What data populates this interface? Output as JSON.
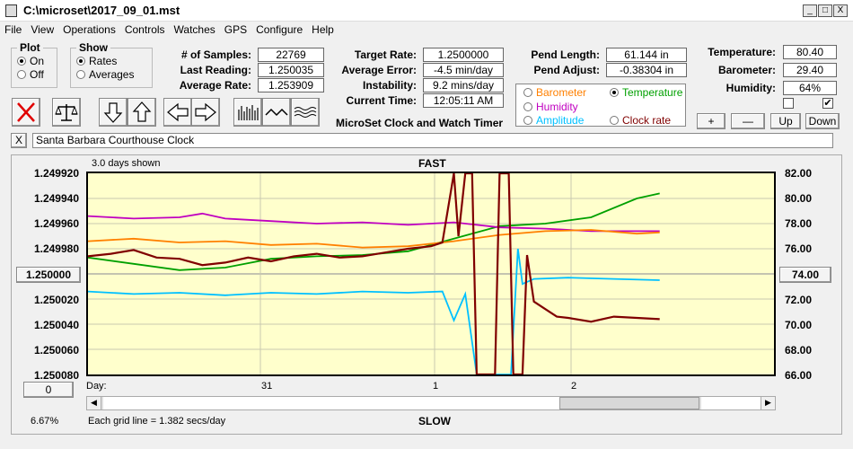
{
  "window": {
    "title": "C:\\microset\\2017_09_01.mst",
    "min": "_",
    "max": "□",
    "close": "X"
  },
  "menu": [
    "File",
    "View",
    "Operations",
    "Controls",
    "Watches",
    "GPS",
    "Configure",
    "Help"
  ],
  "plot_group": {
    "title": "Plot",
    "options": [
      "On",
      "Off"
    ],
    "selected": "On"
  },
  "show_group": {
    "title": "Show",
    "options": [
      "Rates",
      "Averages"
    ],
    "selected": "Rates"
  },
  "stats": {
    "samples_label": "# of Samples:",
    "samples": "22769",
    "last_label": "Last Reading:",
    "last": "1.250035",
    "avg_label": "Average Rate:",
    "avg": "1.253909",
    "target_label": "Target Rate:",
    "target": "1.2500000",
    "avgerr_label": "Average Error:",
    "avgerr": "-4.5 min/day",
    "instab_label": "Instability:",
    "instab": "9.2 mins/day",
    "time_label": "Current Time:",
    "time": "12:05:11 AM",
    "pendlen_label": "Pend Length:",
    "pendlen": "61.144 in",
    "pendadj_label": "Pend Adjust:",
    "pendadj": "-0.38304 in",
    "temp_label": "Temperature:",
    "temp": "80.40",
    "baro_label": "Barometer:",
    "baro": "29.40",
    "hum_label": "Humidity:",
    "hum": "64%"
  },
  "app_name": "MicroSet Clock and Watch Timer",
  "sensor_options": [
    {
      "label": "Barometer",
      "color": "#ff8000",
      "selected": false
    },
    {
      "label": "Temperature",
      "color": "#00a000",
      "selected": true
    },
    {
      "label": "Humidity",
      "color": "#c000c0",
      "selected": false
    },
    {
      "label": "Amplitude",
      "color": "#00c0ff",
      "selected": false
    },
    {
      "label": "Clock rate",
      "color": "#800000",
      "selected": false
    }
  ],
  "axis_buttons": {
    "plus": "+",
    "minus": "—",
    "up": "Up",
    "down": "Down"
  },
  "checkboxes": {
    "left": "",
    "right": "✔"
  },
  "clock_name": "Santa Barbara Courthouse Clock",
  "clear_btn": "X",
  "chart_header": {
    "days_shown": "3.0 days shown",
    "fast": "FAST",
    "slow": "SLOW"
  },
  "left_center_btn": "1.250000",
  "right_center_btn": "74.00",
  "zero_btn": "0",
  "day_label": "Day:",
  "footer_pct": "6.67%",
  "grid_note": "Each grid line = 1.382 secs/day",
  "chart_data": {
    "type": "line",
    "y_left_ticks": [
      "1.249920",
      "1.249940",
      "1.249960",
      "1.249980",
      "1.250000",
      "1.250020",
      "1.250040",
      "1.250060",
      "1.250080"
    ],
    "y_right_ticks": [
      "82.00",
      "80.00",
      "78.00",
      "76.00",
      "74.00",
      "72.00",
      "70.00",
      "68.00",
      "66.00"
    ],
    "x_ticks": [
      "31",
      "1",
      "2"
    ],
    "x_range_days": [
      0,
      3
    ],
    "ylim_left": [
      1.24992,
      1.25008
    ],
    "ylim_right": [
      66,
      82
    ],
    "series": [
      {
        "name": "Clock rate",
        "color": "#800000",
        "points": [
          [
            0,
            75.4
          ],
          [
            0.1,
            75.6
          ],
          [
            0.2,
            75.9
          ],
          [
            0.3,
            75.3
          ],
          [
            0.4,
            75.2
          ],
          [
            0.5,
            74.7
          ],
          [
            0.6,
            74.9
          ],
          [
            0.7,
            75.3
          ],
          [
            0.8,
            75.0
          ],
          [
            0.9,
            75.4
          ],
          [
            1.0,
            75.6
          ],
          [
            1.1,
            75.3
          ],
          [
            1.2,
            75.4
          ],
          [
            1.3,
            75.7
          ],
          [
            1.4,
            76.0
          ],
          [
            1.5,
            76.2
          ],
          [
            1.55,
            76.5
          ],
          [
            1.6,
            82
          ],
          [
            1.62,
            77
          ],
          [
            1.65,
            82
          ],
          [
            1.68,
            82
          ],
          [
            1.7,
            66
          ],
          [
            1.72,
            66
          ],
          [
            1.75,
            66
          ],
          [
            1.78,
            66
          ],
          [
            1.8,
            82
          ],
          [
            1.84,
            82
          ],
          [
            1.86,
            66
          ],
          [
            1.9,
            66
          ],
          [
            1.92,
            75.5
          ],
          [
            1.95,
            71.8
          ],
          [
            2.0,
            71.2
          ],
          [
            2.05,
            70.6
          ],
          [
            2.1,
            70.5
          ],
          [
            2.2,
            70.2
          ],
          [
            2.3,
            70.6
          ],
          [
            2.4,
            70.5
          ],
          [
            2.5,
            70.4
          ]
        ]
      },
      {
        "name": "Temperature",
        "color": "#00a000",
        "points": [
          [
            0,
            75.3
          ],
          [
            0.2,
            74.8
          ],
          [
            0.4,
            74.3
          ],
          [
            0.6,
            74.5
          ],
          [
            0.8,
            75.2
          ],
          [
            1.0,
            75.4
          ],
          [
            1.2,
            75.5
          ],
          [
            1.4,
            75.8
          ],
          [
            1.6,
            76.8
          ],
          [
            1.8,
            77.8
          ],
          [
            2.0,
            78.0
          ],
          [
            2.2,
            78.5
          ],
          [
            2.4,
            80.0
          ],
          [
            2.5,
            80.4
          ]
        ]
      },
      {
        "name": "Humidity",
        "color": "#c000c0",
        "points": [
          [
            0,
            78.6
          ],
          [
            0.2,
            78.4
          ],
          [
            0.4,
            78.5
          ],
          [
            0.5,
            78.8
          ],
          [
            0.6,
            78.4
          ],
          [
            0.8,
            78.2
          ],
          [
            1.0,
            78.0
          ],
          [
            1.2,
            78.1
          ],
          [
            1.4,
            77.9
          ],
          [
            1.6,
            78.1
          ],
          [
            1.8,
            77.7
          ],
          [
            2.0,
            77.6
          ],
          [
            2.2,
            77.4
          ],
          [
            2.4,
            77.4
          ],
          [
            2.5,
            77.4
          ]
        ]
      },
      {
        "name": "Barometer",
        "color": "#ff8000",
        "points": [
          [
            0,
            76.6
          ],
          [
            0.2,
            76.8
          ],
          [
            0.4,
            76.5
          ],
          [
            0.6,
            76.6
          ],
          [
            0.8,
            76.3
          ],
          [
            1.0,
            76.4
          ],
          [
            1.2,
            76.1
          ],
          [
            1.4,
            76.2
          ],
          [
            1.6,
            76.6
          ],
          [
            1.8,
            77.1
          ],
          [
            2.0,
            77.4
          ],
          [
            2.2,
            77.5
          ],
          [
            2.4,
            77.2
          ],
          [
            2.5,
            77.3
          ]
        ]
      },
      {
        "name": "Amplitude",
        "color": "#00c0ff",
        "points": [
          [
            0,
            72.6
          ],
          [
            0.2,
            72.4
          ],
          [
            0.4,
            72.5
          ],
          [
            0.6,
            72.3
          ],
          [
            0.8,
            72.5
          ],
          [
            1.0,
            72.4
          ],
          [
            1.2,
            72.6
          ],
          [
            1.4,
            72.5
          ],
          [
            1.55,
            72.6
          ],
          [
            1.6,
            70.3
          ],
          [
            1.65,
            72.4
          ],
          [
            1.7,
            66
          ],
          [
            1.85,
            66
          ],
          [
            1.88,
            76
          ],
          [
            1.9,
            73.2
          ],
          [
            1.95,
            73.6
          ],
          [
            2.1,
            73.7
          ],
          [
            2.3,
            73.6
          ],
          [
            2.5,
            73.5
          ]
        ]
      }
    ]
  }
}
